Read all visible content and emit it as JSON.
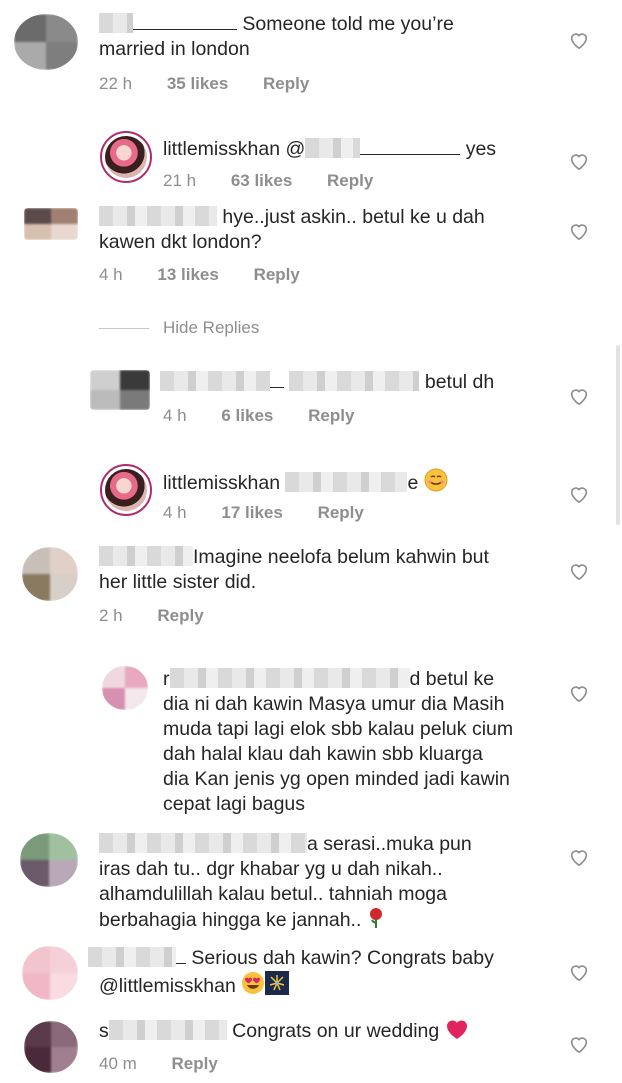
{
  "comments": [
    {
      "line1_suffix": "Someone told me you’re",
      "line2": "married in london",
      "time": "22 h",
      "likes": "35 likes",
      "reply": "Reply"
    },
    {
      "username": "littlemisskhan",
      "at": "@",
      "text_suffix": "yes",
      "time": "21 h",
      "likes": "63 likes",
      "reply": "Reply"
    },
    {
      "line1_suffix": "hye..just askin.. betul ke u dah",
      "line2": "kawen dkt london?",
      "time": "4 h",
      "likes": "13 likes",
      "reply": "Reply"
    },
    {
      "text_suffix": "betul dh",
      "time": "4 h",
      "likes": "6 likes",
      "reply": "Reply"
    },
    {
      "username": "littlemisskhan",
      "text_suffix": "e",
      "time": "4 h",
      "likes": "17 likes",
      "reply": "Reply"
    },
    {
      "line1_suffix": "Imagine neelofa belum kahwin but",
      "line2": "her little sister did.",
      "time": "2 h",
      "reply": "Reply"
    },
    {
      "line1_prefix": "r",
      "line1_suffix": "d betul ke",
      "lines": [
        "dia ni dah kawin Masya umur dia Masih",
        "muda tapi lagi elok sbb kalau peluk cium",
        "dah halal klau dah kawin sbb kluarga",
        "dia Kan jenis yg open minded jadi kawin",
        "cepat lagi bagus"
      ]
    },
    {
      "line1_suffix": "a serasi..muka pun",
      "lines": [
        "iras dah tu.. dgr khabar yg u dah nikah..",
        "alhamdulillah kalau betul.. tahniah moga",
        "berbahagia hingga ke jannah.."
      ]
    },
    {
      "line1_suffix": "Serious dah kawin? Congrats baby",
      "line2": "@littlemisskhan"
    },
    {
      "line1_prefix": "s",
      "line1_suffix": "Congrats on ur wedding",
      "time": "40 m",
      "reply": "Reply"
    }
  ],
  "hide_replies": "Hide Replies",
  "colors": {
    "meta": "#8e8e8e",
    "text": "#262626",
    "heart_outline": "#8e8e8e"
  }
}
